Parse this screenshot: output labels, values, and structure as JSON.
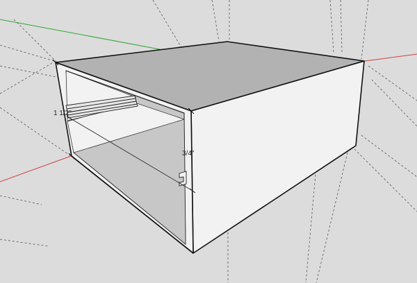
{
  "viewport": {
    "background_color": "#dcdcdc"
  },
  "model": {
    "name": "cabinet-box",
    "top_face_color": "#b2b2b2",
    "side_face_color": "#f2f2f2",
    "inner_color": "#c7c7c7",
    "edge_color": "#111111"
  },
  "axes": {
    "red_axis_color": "#d04040",
    "green_axis_color": "#2fa52f",
    "blue_axis_color": "#2a4fd8"
  },
  "dimensions": {
    "left_label": "1 1/2\"",
    "center_label": "3/4\""
  }
}
